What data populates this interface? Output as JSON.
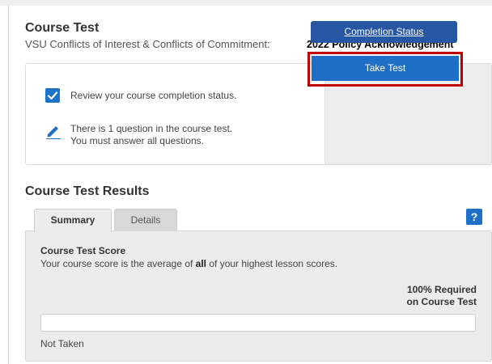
{
  "header": {
    "title": "Course Test",
    "subtitle": "VSU Conflicts of Interest & Conflicts of Commitment: ",
    "subtitle_overlay": "2022 Policy Acknowledgement"
  },
  "panel": {
    "review_text": "Review your course completion status.",
    "question_line1": "There is 1 question in the course test.",
    "question_line2": "You must answer all questions.",
    "completion_button": "Completion Status",
    "take_test_button": "Take Test"
  },
  "results": {
    "title": "Course Test Results",
    "tabs": [
      "Summary",
      "Details"
    ],
    "help_label": "?",
    "score_title": "Course Test Score",
    "score_desc_before": "Your course score is the average of ",
    "score_desc_bold": "all",
    "score_desc_after": " of your highest lesson scores.",
    "required_line1": "100% Required",
    "required_line2": "on Course Test",
    "progress": 0,
    "status": "Not Taken"
  },
  "colors": {
    "accent": "#1f6fc6",
    "dark_button": "#2756a3",
    "highlight_border": "#c00000"
  },
  "icons": [
    "checkbox-checked-icon",
    "pencil-icon",
    "help-icon"
  ]
}
